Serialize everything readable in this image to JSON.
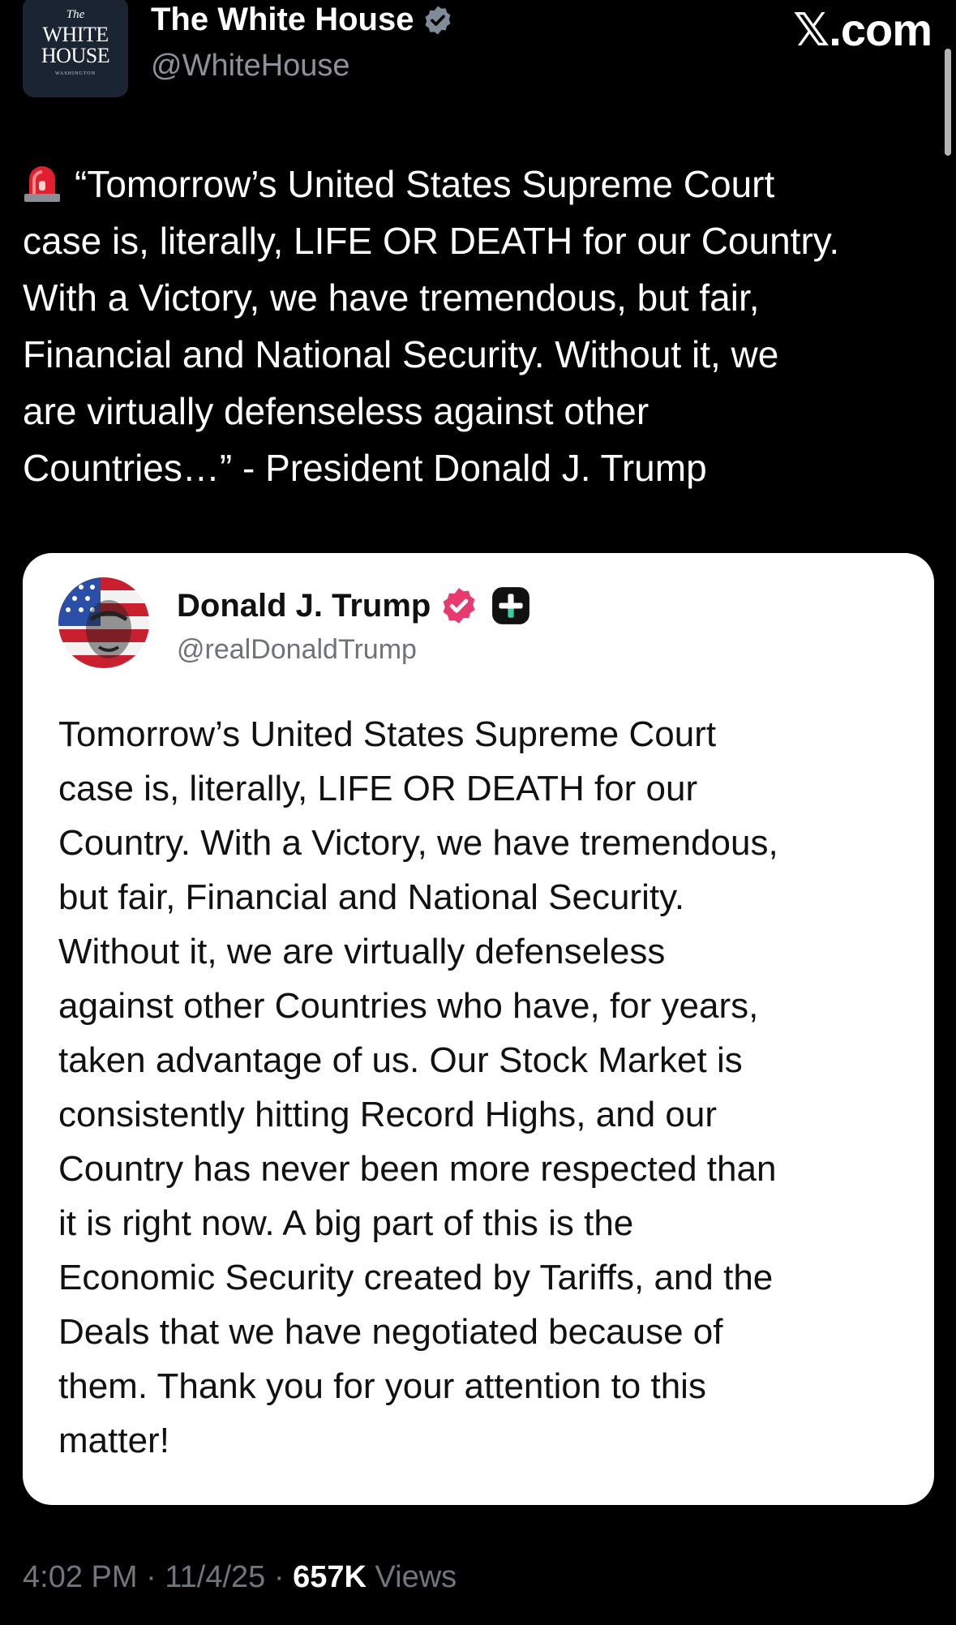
{
  "account": {
    "display_name": "The White House",
    "handle": "@WhiteHouse",
    "avatar_logo": {
      "line1": "The",
      "line2": "WHITE HOUSE",
      "line3": "WASHINGTON"
    },
    "verified_icon": "verified-badge-gray-icon"
  },
  "site_label": "𝕏.com",
  "post": {
    "emoji": "siren-icon",
    "text": "“Tomorrow’s United States Supreme Court\ncase is, literally, LIFE OR DEATH for our Country.\nWith a Victory, we have tremendous, but fair,\nFinancial and National Security. Without it, we\nare virtually defenseless against other\nCountries…” - President Donald J. Trump"
  },
  "quoted_post": {
    "display_name": "Donald J. Trump",
    "handle": "@realDonaldTrump",
    "verified_icon": "verified-badge-pink-icon",
    "extra_badge_icon": "plus-badge-icon",
    "text": "Tomorrow’s United States Supreme Court\ncase is, literally, LIFE OR DEATH for our\nCountry. With a Victory, we have tremendous,\nbut fair, Financial and National Security.\nWithout it, we are virtually defenseless\nagainst other Countries who have, for years,\ntaken advantage of us. Our Stock Market is\nconsistently hitting Record Highs, and our\nCountry has never been more respected than\nit is right now. A big part of this is the\nEconomic Security created by Tariffs, and the\nDeals that we have negotiated because of\nthem. Thank you for your attention to this\nmatter!"
  },
  "meta": {
    "time": "4:02 PM",
    "separator": " · ",
    "date": "11/4/25",
    "views_count": "657K",
    "views_label": "Views"
  },
  "colors": {
    "background": "#000000",
    "secondary_text": "#6f767d",
    "verified_gray": "#7f8b99",
    "verified_pink": "#e83a6e"
  }
}
